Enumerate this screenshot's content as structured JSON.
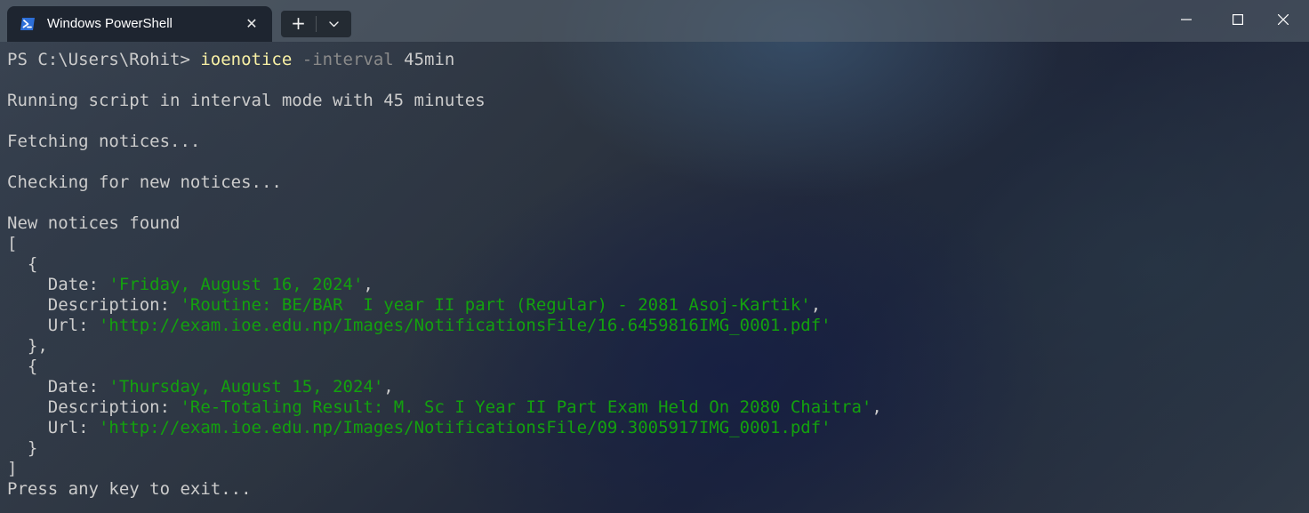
{
  "window": {
    "tab_title": "Windows PowerShell",
    "tab_icon": "powershell-icon",
    "new_tab_icon": "plus-icon",
    "dropdown_icon": "chevron-down-icon",
    "controls": [
      "minimize-icon",
      "maximize-icon",
      "close-icon"
    ]
  },
  "colors": {
    "text": "#cccccc",
    "command": "#f9f1a5",
    "parameter": "#8a8a8a",
    "string": "#13a10e"
  },
  "terminal": {
    "prompt": "PS C:\\Users\\Rohit> ",
    "command": "ioenotice",
    "param": "-interval",
    "arg": "45min",
    "running": "Running script in interval mode with 45 minutes",
    "fetching": "Fetching notices...",
    "checking": "Checking for new notices...",
    "found": "New notices found",
    "array_open": "[",
    "array_close": "]",
    "notices": [
      {
        "date_key": "Date: ",
        "date": "'Friday, August 16, 2024'",
        "desc_key": "Description: ",
        "desc": "'Routine: BE/BAR  I year II part (Regular) - 2081 Asoj-Kartik'",
        "url_key": "Url: ",
        "url": "'http://exam.ioe.edu.np/Images/NotificationsFile/16.6459816IMG_0001.pdf'"
      },
      {
        "date_key": "Date: ",
        "date": "'Thursday, August 15, 2024'",
        "desc_key": "Description: ",
        "desc": "'Re-Totaling Result: M. Sc I Year II Part Exam Held On 2080 Chaitra'",
        "url_key": "Url: ",
        "url": "'http://exam.ioe.edu.np/Images/NotificationsFile/09.3005917IMG_0001.pdf'"
      }
    ],
    "obj_open": "  {",
    "obj_close_comma": "  },",
    "obj_close": "  }",
    "indent": "    ",
    "comma": ",",
    "exit": "Press any key to exit..."
  }
}
